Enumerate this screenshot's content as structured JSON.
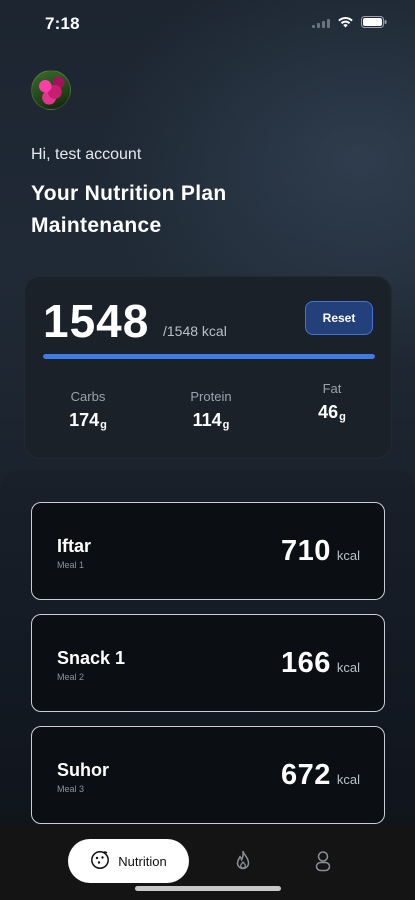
{
  "status": {
    "time": "7:18"
  },
  "header": {
    "greeting": "Hi, test account",
    "title_line1": "Your Nutrition Plan",
    "title_line2": "Maintenance"
  },
  "summary": {
    "calories": "1548",
    "target_text": "/1548 kcal",
    "progress_fraction": 1.0,
    "reset_label": "Reset",
    "macros": [
      {
        "label": "Carbs",
        "value": "174",
        "unit": "g"
      },
      {
        "label": "Protein",
        "value": "114",
        "unit": "g"
      },
      {
        "label": "Fat",
        "value": "46",
        "unit": "g"
      }
    ]
  },
  "meals": [
    {
      "name": "Iftar",
      "subtitle": "Meal 1",
      "kcal": "710",
      "unit": "kcal"
    },
    {
      "name": "Snack 1",
      "subtitle": "Meal 2",
      "kcal": "166",
      "unit": "kcal"
    },
    {
      "name": "Suhor",
      "subtitle": "Meal 3",
      "kcal": "672",
      "unit": "kcal"
    }
  ],
  "nav": {
    "active_label": "Nutrition",
    "items": [
      {
        "icon": "nutrition-icon"
      },
      {
        "icon": "flame-icon"
      },
      {
        "icon": "profile-icon"
      }
    ]
  },
  "colors": {
    "accent": "#3f7be6",
    "reset_bg": "#23407a"
  }
}
